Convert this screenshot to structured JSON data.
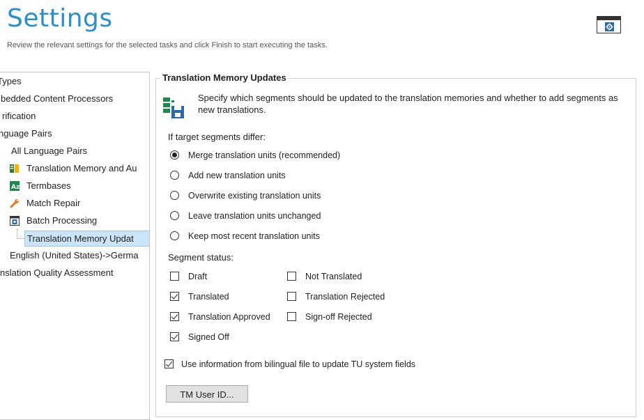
{
  "header": {
    "title": "Settings",
    "subtitle": "Review the relevant settings for the selected tasks and click Finish to start executing the tasks."
  },
  "tree": {
    "items": [
      {
        "label": "Types"
      },
      {
        "label": "bedded Content Processors"
      },
      {
        "label": "rification"
      },
      {
        "label": "nguage Pairs"
      },
      {
        "label": "All Language Pairs"
      },
      {
        "label": "Translation Memory and Au"
      },
      {
        "label": "Termbases"
      },
      {
        "label": "Match Repair"
      },
      {
        "label": "Batch Processing"
      },
      {
        "label": "Translation Memory Updat"
      },
      {
        "label": "English (United States)->Germa"
      },
      {
        "label": "nslation Quality Assessment"
      }
    ]
  },
  "panel": {
    "group_title": "Translation Memory Updates",
    "intro": "Specify which segments should be updated to the translation memories and whether to add segments as new translations.",
    "differ_label": "If target segments differ:",
    "radios": [
      {
        "label": "Merge translation units (recommended)",
        "checked": true
      },
      {
        "label": "Add new translation units",
        "checked": false
      },
      {
        "label": "Overwrite existing translation units",
        "checked": false
      },
      {
        "label": "Leave translation units unchanged",
        "checked": false
      },
      {
        "label": "Keep most recent translation units",
        "checked": false
      }
    ],
    "status_label": "Segment status:",
    "status_left": [
      {
        "label": "Draft",
        "checked": false
      },
      {
        "label": "Translated",
        "checked": true
      },
      {
        "label": "Translation Approved",
        "checked": true
      },
      {
        "label": "Signed Off",
        "checked": true
      }
    ],
    "status_right": [
      {
        "label": "Not Translated",
        "checked": false
      },
      {
        "label": "Translation Rejected",
        "checked": false
      },
      {
        "label": "Sign-off Rejected",
        "checked": false
      }
    ],
    "bilingual": {
      "label": "Use information from bilingual file to update TU system fields",
      "checked": true
    },
    "tm_user_button": "TM User ID..."
  }
}
